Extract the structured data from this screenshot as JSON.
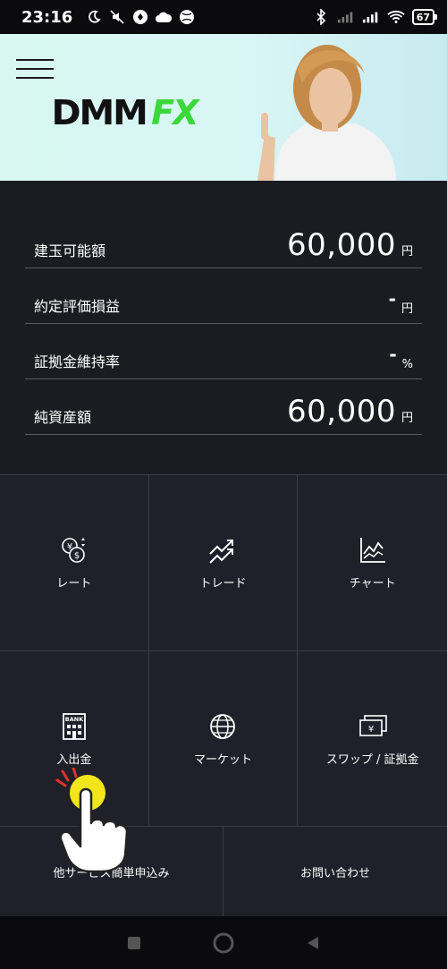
{
  "status_bar": {
    "time": "23:16",
    "battery": "67"
  },
  "banner": {
    "brand_dmm": "DMM",
    "brand_fx": "FX"
  },
  "account": {
    "rows": [
      {
        "label": "建玉可能額",
        "value": "60,000",
        "unit": "円"
      },
      {
        "label": "約定評価損益",
        "value": "-",
        "unit": "円"
      },
      {
        "label": "証拠金維持率",
        "value": "-",
        "unit": "%"
      },
      {
        "label": "純資産額",
        "value": "60,000",
        "unit": "円"
      }
    ]
  },
  "menu": {
    "rate": "レート",
    "trade": "トレード",
    "chart": "チャート",
    "deposit": "入出金",
    "market": "マーケット",
    "swap": "スワップ / 証拠金",
    "other_service": "他サービス簡単申込み",
    "contact": "お問い合わせ"
  },
  "colors": {
    "background": "#1b1c22",
    "accent_green": "#3ad93a",
    "banner_bg": "#d7f7f0",
    "tap_yellow": "#f2e51b"
  },
  "icons": [
    "rate-yen-dollar-icon",
    "trade-arrows-icon",
    "chart-icon",
    "bank-icon",
    "globe-icon",
    "swap-yen-icon"
  ]
}
